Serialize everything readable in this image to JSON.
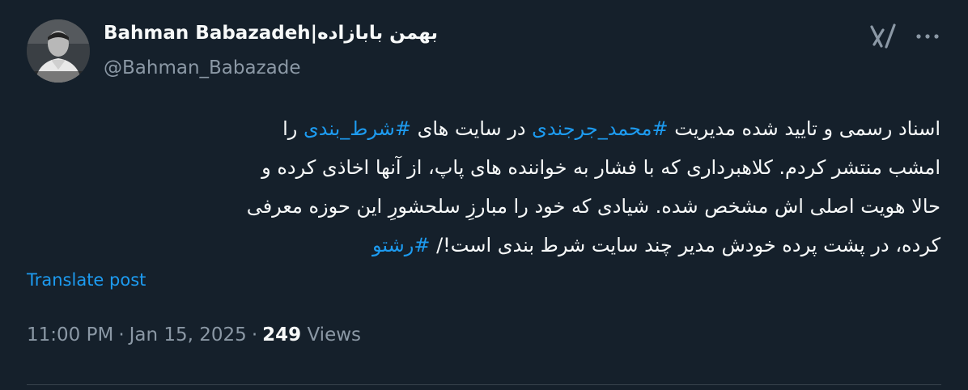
{
  "author": {
    "display_name": "Bahman Babazadeh|بهمن بابازاده",
    "handle": "@Bahman_Babazade",
    "avatar_icon": "profile-photo"
  },
  "header_icons": {
    "grok": "grok-icon",
    "more": "more-options-icon"
  },
  "tweet": {
    "lines": [
      [
        {
          "text": "اسناد رسمی و تایید شده مدیریت  ",
          "hashtag": false
        },
        {
          "text": "#محمد_جرجندی",
          "hashtag": true
        },
        {
          "text": " در سایت های ",
          "hashtag": false
        },
        {
          "text": "#شرط_بندی",
          "hashtag": true
        },
        {
          "text": " را",
          "hashtag": false
        }
      ],
      [
        {
          "text": "امشب منتشر کردم. کلاهبرداری که با فشار به خواننده های پاپ، از آنها اخاذی کرده و",
          "hashtag": false
        }
      ],
      [
        {
          "text": "حالا هویت اصلی اش مشخص شده. شیادی که خود را مبارزِ سلحشورِ این حوزه معرفی",
          "hashtag": false
        }
      ],
      [
        {
          "text": "کرده، در پشت پرده خودش مدیر چند سایت شرط بندی است!/ ",
          "hashtag": false
        },
        {
          "text": "#رشتو",
          "hashtag": true
        }
      ]
    ]
  },
  "translate_label": "Translate post",
  "meta": {
    "time": "11:00 PM",
    "separator": "·",
    "date": "Jan 15, 2025",
    "views_count": "249",
    "views_label": "Views"
  },
  "colors": {
    "background": "#15202b",
    "text_primary": "#f7f9f9",
    "text_secondary": "#8b98a5",
    "accent": "#1d9bf0",
    "divider": "#38444d"
  }
}
